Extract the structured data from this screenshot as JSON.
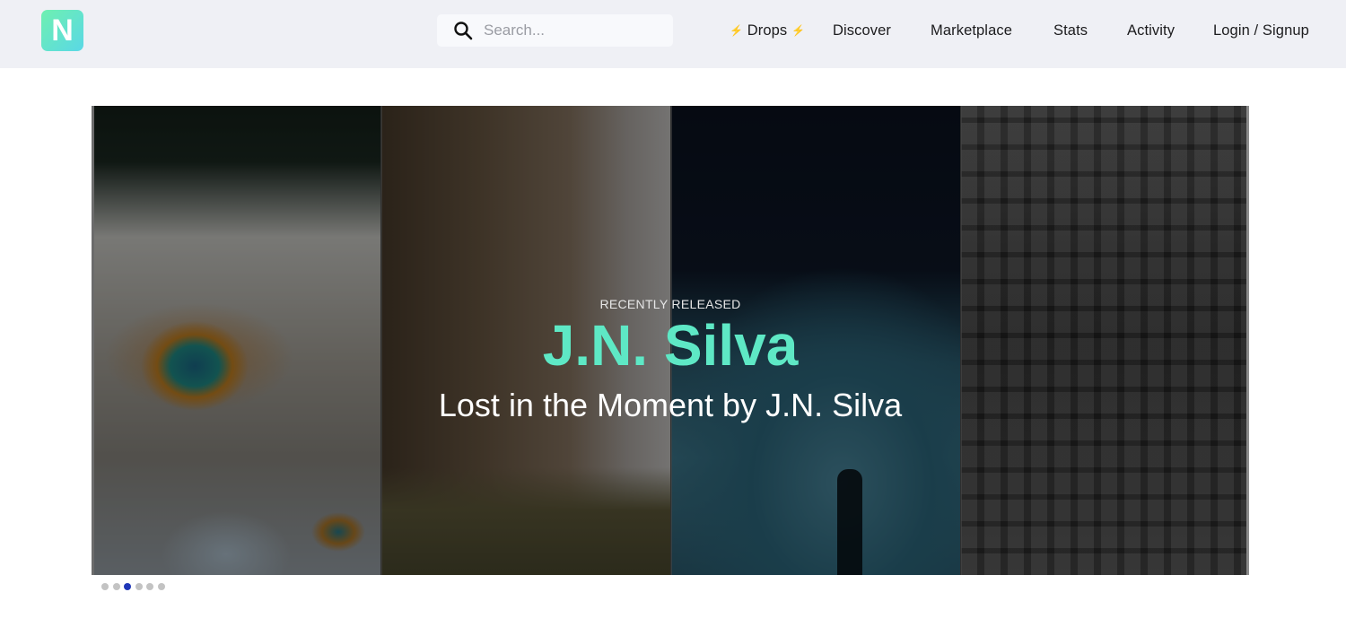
{
  "header": {
    "logo_letter": "N",
    "search": {
      "placeholder": "Search...",
      "value": ""
    },
    "nav": [
      {
        "label": "Drops",
        "prefix_icon": "⚡",
        "suffix_icon": "⚡"
      },
      {
        "label": "Discover"
      },
      {
        "label": "Marketplace"
      },
      {
        "label": "Stats"
      },
      {
        "label": "Activity"
      },
      {
        "label": "Login / Signup"
      }
    ]
  },
  "hero": {
    "eyebrow": "RECENTLY RELEASED",
    "title": "J.N. Silva",
    "subtitle": "Lost in the Moment by J.N. Silva",
    "panels": [
      {
        "subject": "aerial hot spring"
      },
      {
        "subject": "zebras by cliff"
      },
      {
        "subject": "figure on stone slope at night"
      },
      {
        "subject": "aerial city skyline"
      }
    ],
    "accent_color": "#5ee8c5"
  },
  "carousel": {
    "total_slides": 6,
    "active_index": 2,
    "active_color": "#2037b8",
    "inactive_color": "#c3c3c3"
  }
}
